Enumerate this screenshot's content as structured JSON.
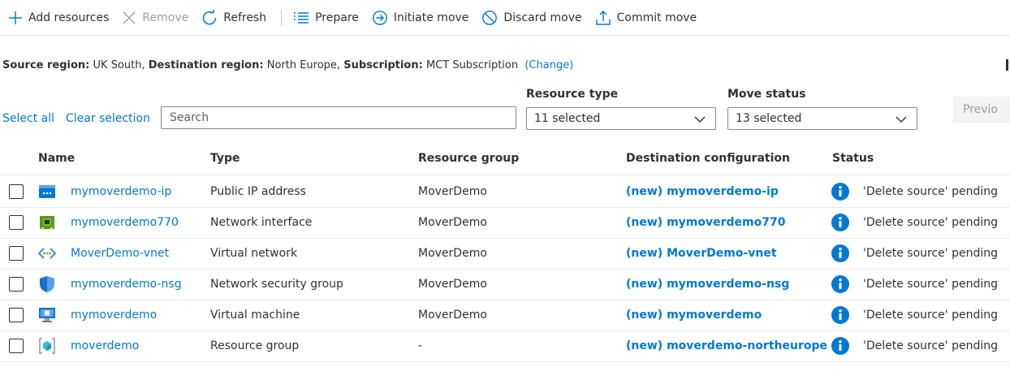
{
  "toolbar": {
    "add": "Add resources",
    "remove": "Remove",
    "refresh": "Refresh",
    "prepare": "Prepare",
    "initiate": "Initiate move",
    "discard": "Discard move",
    "commit": "Commit move"
  },
  "summary": {
    "source_label": "Source region:",
    "source_value": "UK South,",
    "dest_label": "Destination region:",
    "dest_value": "North Europe,",
    "sub_label": "Subscription:",
    "sub_value": "MCT Subscription",
    "change": "(Change)"
  },
  "filters": {
    "select_all": "Select all",
    "clear_selection": "Clear selection",
    "search_placeholder": "Search",
    "resource_type_label": "Resource type",
    "resource_type_value": "11 selected",
    "move_status_label": "Move status",
    "move_status_value": "13 selected",
    "previous": "Previo"
  },
  "table": {
    "headers": {
      "name": "Name",
      "type": "Type",
      "rg": "Resource group",
      "dest": "Destination configuration",
      "status": "Status"
    },
    "rows": [
      {
        "name": "mymoverdemo-ip",
        "type": "Public IP address",
        "rg": "MoverDemo",
        "dest": "(new) mymoverdemo-ip",
        "status": "'Delete source' pending",
        "icon": "public-ip-icon"
      },
      {
        "name": "mymoverdemo770",
        "type": "Network interface",
        "rg": "MoverDemo",
        "dest": "(new) mymoverdemo770",
        "status": "'Delete source' pending",
        "icon": "network-interface-icon"
      },
      {
        "name": "MoverDemo-vnet",
        "type": "Virtual network",
        "rg": "MoverDemo",
        "dest": "(new) MoverDemo-vnet",
        "status": "'Delete source' pending",
        "icon": "virtual-network-icon"
      },
      {
        "name": "mymoverdemo-nsg",
        "type": "Network security group",
        "rg": "MoverDemo",
        "dest": "(new) mymoverdemo-nsg",
        "status": "'Delete source' pending",
        "icon": "shield-icon"
      },
      {
        "name": "mymoverdemo",
        "type": "Virtual machine",
        "rg": "MoverDemo",
        "dest": "(new) mymoverdemo",
        "status": "'Delete source' pending",
        "icon": "virtual-machine-icon"
      },
      {
        "name": "moverdemo",
        "type": "Resource group",
        "rg": "-",
        "dest": "(new) moverdemo-northeurope",
        "status": "'Delete source' pending",
        "icon": "resource-group-icon"
      }
    ]
  },
  "colors": {
    "accent": "#0078d4",
    "disabled": "#a19f9d",
    "text": "#323130"
  }
}
